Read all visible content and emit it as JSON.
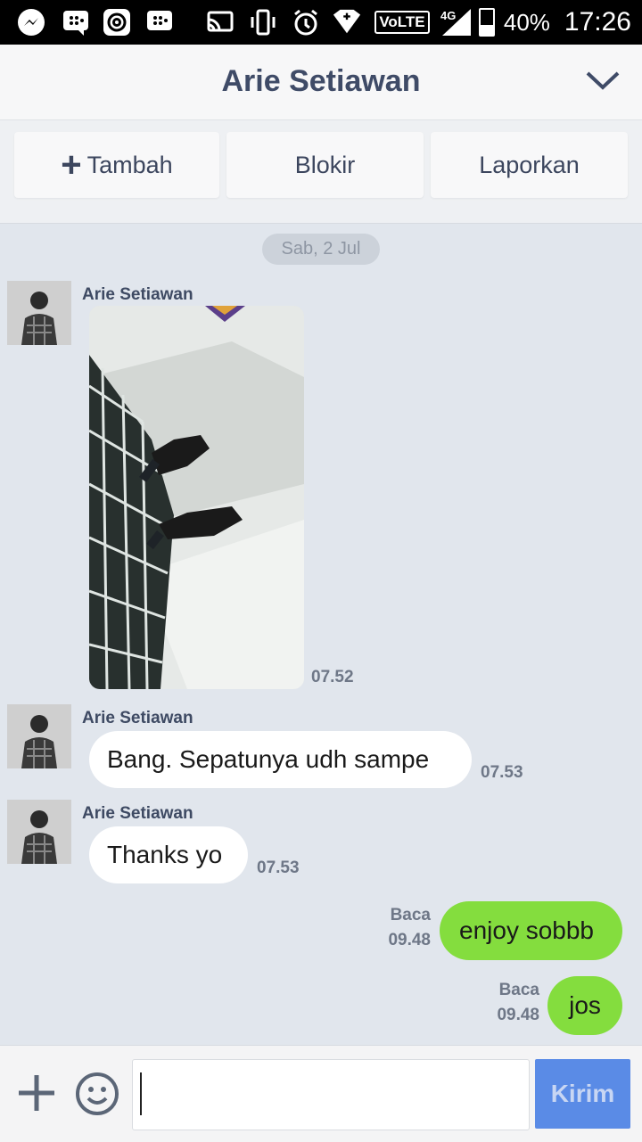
{
  "statusbar": {
    "battery_percent": "40%",
    "clock": "17:26",
    "network": "4G",
    "volte": "VoLTE",
    "icons": [
      "messenger-icon",
      "bbm-icon",
      "at-sign-icon",
      "bbm-icon",
      "cast-icon",
      "vibrate-icon",
      "alarm-icon",
      "data-saver-icon",
      "volte-icon",
      "signal-icon",
      "battery-icon"
    ]
  },
  "header": {
    "title": "Arie Setiawan"
  },
  "actions": {
    "add": "Tambah",
    "block": "Blokir",
    "report": "Laporkan"
  },
  "chat": {
    "date": "Sab, 2 Jul",
    "incoming": [
      {
        "sender": "Arie Setiawan",
        "type": "image",
        "time": "07.52"
      },
      {
        "sender": "Arie Setiawan",
        "text": "Bang. Sepatunya udh sampe",
        "time": "07.53"
      },
      {
        "sender": "Arie Setiawan",
        "text": "Thanks yo",
        "time": "07.53"
      }
    ],
    "outgoing": [
      {
        "text": "enjoy sobbb",
        "status": "Baca",
        "time": "09.48"
      },
      {
        "text": "jos",
        "status": "Baca",
        "time": "09.48"
      }
    ]
  },
  "composer": {
    "send_label": "Kirim",
    "value": ""
  },
  "colors": {
    "bubble_out": "#84dd3e",
    "send_button": "#5a8be6",
    "chat_bg": "#e1e6ed"
  }
}
